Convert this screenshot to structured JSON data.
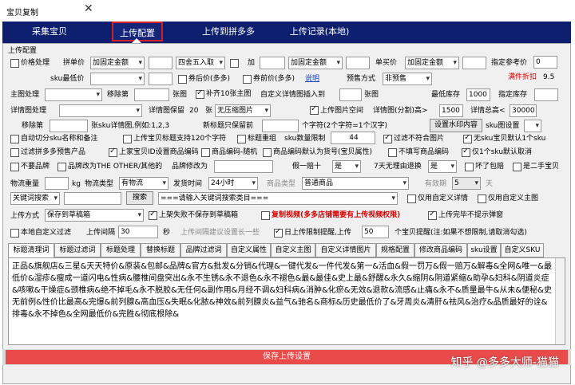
{
  "window": {
    "title": "宝贝复制",
    "close": "✕"
  },
  "nav": {
    "tabs": [
      "采集宝贝",
      "上传配置",
      "上传到拼多多",
      "上传记录(本地)"
    ]
  },
  "section": "上传配置",
  "r1": {
    "price_cb": "价格处理",
    "group_price": "拼单价",
    "group_sel": "加固定金额",
    "round_sel": "四舍五入取",
    "add": "加",
    "amt_sel": "加固定金额",
    "single": "单买价",
    "single_sel": "加固定金额",
    "ref": "指定参考价",
    "ref_val": "0"
  },
  "r2": {
    "sku_min": "sku最低价",
    "after_coupon": "券后价(多多)",
    "before_coupon": "券前价(多多)",
    "explain": "说明",
    "presale": "预售方式",
    "presale_sel": "非预售",
    "discount": "满件折扣",
    "discount_val": "9.5"
  },
  "r3": {
    "main_img": "主图处理",
    "remove": "移除第",
    "img_unit": "张图",
    "fill": "补齐10张主图",
    "custom_insert": "自定义详情图插入到",
    "img_unit2": "张图"
  },
  "r4": {
    "detail_img": "详情图处理",
    "keep": "详情图保留",
    "keep_val": "20",
    "keep_unit": "张",
    "keep_sel": "无压缩图片",
    "detail_space": "上传图片空间",
    "split": "详情图(分割)高>",
    "split_val": "1500",
    "total": "详情总高<",
    "total_val": "30000",
    "min_stock": "最低库存",
    "min_stock_val": "1000",
    "set_stock": "指定库存"
  },
  "r5": {
    "remove_no": "移除第",
    "sku_rule": "张sku详情图,例如:1,2,3",
    "new_title": "新标题只保留前",
    "chars": "个字符(2个字符=1个汉字)",
    "watermark": "设置水印内容",
    "sku_set": "sku图设置"
  },
  "r6": {
    "c1": "自动切分sku名称和备注",
    "c2": "上传宝贝标题支持120个字符",
    "c3": "标题重组",
    "sku_limit": "sku数量限制",
    "sku_limit_val": "44",
    "c4": "过滤不符合图片",
    "c5": "无sku宝贝默认1个sku"
  },
  "r7": {
    "c1": "过滤拼多多预售产品",
    "c2": "上家宝贝ID设置商品编码",
    "c3": "商品编码-随机",
    "c4": "商品编码默认为货号(宝贝属性)",
    "c5": "不填写商品编码",
    "c6": "仅1个sku默认取消"
  },
  "r8": {
    "c1": "不要品牌",
    "c2": "品牌改为THE OTHER/其他的",
    "brand_mod": "品牌修改为",
    "fake": "假一赔十",
    "fake_sel": "是",
    "seven": "7天无理由退换",
    "seven_sel": "是",
    "bad": "坏了包赔",
    "second": "是二手宝贝"
  },
  "r9": {
    "weight": "物流重量",
    "kg": "kg",
    "type": "物流类型",
    "type_sel": "有物流",
    "ship": "发货时间",
    "ship_sel": "24小时",
    "cat": "商品类型",
    "cat_sel": "普通商品",
    "valid": "有效期",
    "valid_sel": "5",
    "day": "天"
  },
  "r10": {
    "kw_sel": "关键词搜索",
    "search": "搜索",
    "kw_hint": "===请输入关键词搜索类目===",
    "c1": "仅用自定义详情",
    "c2": "仅用自定义主图"
  },
  "r11": {
    "mode": "上传方式",
    "mode_sel": "保存到草稿箱",
    "c1": "上架失败不保存到草稿箱",
    "c2": "复制视频(多多店铺需要有上传视频权限)",
    "c3": "上传完毕不提示弹窗"
  },
  "r12": {
    "c1": "本地自定义过滤",
    "interval": "上传间隔",
    "interval_val": "30",
    "sec": "秒",
    "advice": "上传间隔建议设置长一些",
    "daily": "日上传限制提醒,上传",
    "daily_val": "50",
    "daily_note": "个宝贝提醒(注:如果不想限制,请取消勾选)"
  },
  "tabs2": [
    "标题清理词",
    "标题过滤词",
    "标题处理",
    "替换标题",
    "品牌过滤词",
    "自定义属性",
    "自定义主图",
    "自定义详情图片",
    "规格配置",
    "修改商品编码",
    "sku设置",
    "自定义SKU"
  ],
  "text": "正品&旗舰店&三星&天天特价&原装&包邮&品牌&官方&批发&分销&代理&一键代发&一件代发&第一&活血&假一罚万&假一赔万&解毒&全网&唯一&最低价&湿疹&瘦成一道闪电&性病&腰椎间盘突出&永不生锈&永不退色&永不褪色&最&最佳&史上最&舒醒&永久&缩阴&阴道紧缩&助孕&妇科&阴道炎症&咳嗽&干燥症&颈椎病&绝不掉毛&永不脱胶&无任何&副作用&月经不调&妇科病&消肿&化瘀&无效&退款&流感&止痛&永不&质量最牛&从未&便秘&史无前例&性价比最高&完爆&前列腺&高血压&失眠&化脓&神效&前列腺炎&益气&驰名&商标&历史最低价了&牙周炎&清肝&祛风&治疗&品质最好的诠&排毒&永不掉色&全网最低价&完胜&彻底根除&",
  "save": "保存上传设置",
  "watermark": "知乎 @多多大师-猫猫"
}
